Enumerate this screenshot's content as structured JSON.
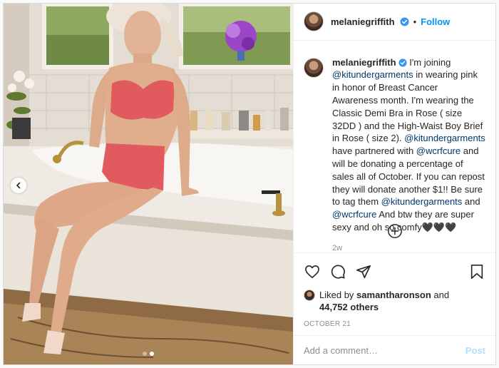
{
  "post": {
    "username": "melaniegriffith",
    "follow_label": "Follow",
    "separator": "•",
    "caption": {
      "username": "melaniegriffith",
      "segments": [
        {
          "type": "text",
          "value": " I'm joining "
        },
        {
          "type": "mention",
          "value": "@kitundergarments"
        },
        {
          "type": "text",
          "value": " in wearing pink in honor of Breast Cancer Awareness month. I'm wearing the Classic Demi Bra in Rose ( size 32DD ) and the High-Waist Boy Brief in Rose ( size 2). "
        },
        {
          "type": "mention",
          "value": "@kitundergarments"
        },
        {
          "type": "text",
          "value": " have partnered with "
        },
        {
          "type": "mention",
          "value": "@wcrfcure"
        },
        {
          "type": "text",
          "value": " and will be donating a percentage of sales all of October. If you can repost they will donate another $1!! Be sure to tag them "
        },
        {
          "type": "mention",
          "value": "@kitundergarments"
        },
        {
          "type": "text",
          "value": " and "
        },
        {
          "type": "mention",
          "value": "@wcrfcure"
        },
        {
          "type": "text",
          "value": " And btw they are super sexy and oh so comfy🖤🖤🖤"
        }
      ],
      "time_ago": "2w"
    },
    "likes": {
      "prefix": "Liked by ",
      "liker": "samantharonson",
      "conjunction": " and",
      "others": "44,752 others"
    },
    "date": "OCTOBER 21",
    "comment": {
      "placeholder": "Add a comment…",
      "post_label": "Post"
    },
    "carousel": {
      "total": 2,
      "active": 2
    },
    "icons": [
      "chevron-left-icon",
      "verified-badge-icon",
      "heart-icon",
      "comment-icon",
      "share-icon",
      "bookmark-icon",
      "plus-circle-icon"
    ],
    "colors": {
      "link": "#0095f6",
      "mention": "#00376b",
      "muted": "#8e8e8e",
      "post_disabled": "#b2dffc",
      "verified": "#3897f0"
    }
  }
}
